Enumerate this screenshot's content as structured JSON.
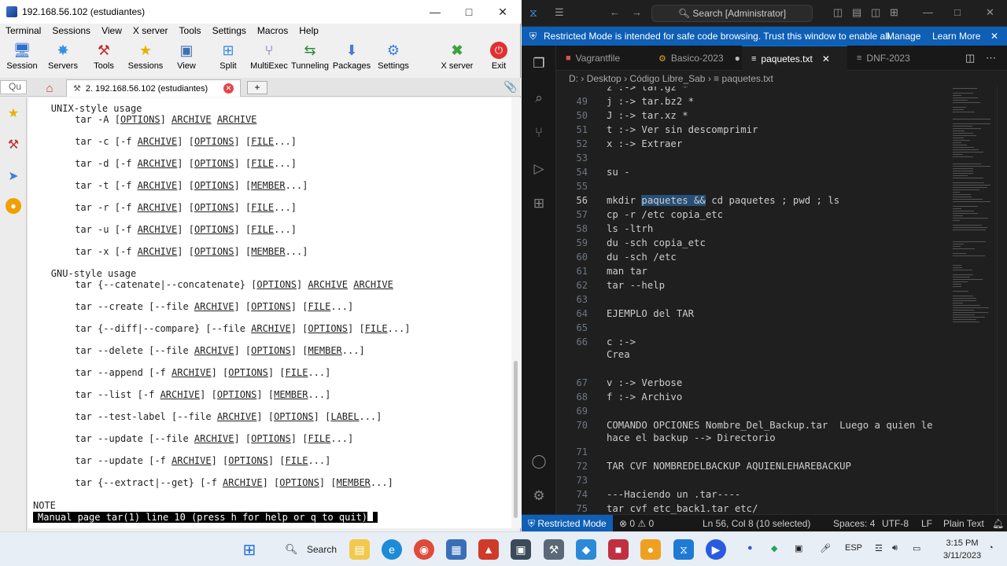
{
  "mobaxterm": {
    "window_title": "192.168.56.102 (estudiantes)",
    "menu": [
      "Terminal",
      "Sessions",
      "View",
      "X server",
      "Tools",
      "Settings",
      "Macros",
      "Help"
    ],
    "toolbar": [
      "Session",
      "Servers",
      "Tools",
      "Sessions",
      "View",
      "Split",
      "MultiExec",
      "Tunneling",
      "Packages",
      "Settings",
      "X server",
      "Exit"
    ],
    "quick_connect": "Qu",
    "session_tab": "2. 192.168.56.102 (estudiantes)",
    "terminal_lines": [
      {
        "text": "UNIX-style usage",
        "indent": 3
      },
      {
        "text": "tar -A [OPTIONS] ARCHIVE ARCHIVE",
        "indent": 7
      },
      {
        "text": "tar -c [-f ARCHIVE] [OPTIONS] [FILE...]",
        "indent": 7
      },
      {
        "text": "tar -d [-f ARCHIVE] [OPTIONS] [FILE...]",
        "indent": 7
      },
      {
        "text": "tar -t [-f ARCHIVE] [OPTIONS] [MEMBER...]",
        "indent": 7
      },
      {
        "text": "tar -r [-f ARCHIVE] [OPTIONS] [FILE...]",
        "indent": 7
      },
      {
        "text": "tar -u [-f ARCHIVE] [OPTIONS] [FILE...]",
        "indent": 7
      },
      {
        "text": "tar -x [-f ARCHIVE] [OPTIONS] [MEMBER...]",
        "indent": 7
      },
      {
        "text": "GNU-style usage",
        "indent": 3
      },
      {
        "text": "tar {--catenate|--concatenate} [OPTIONS] ARCHIVE ARCHIVE",
        "indent": 7
      },
      {
        "text": "tar --create [--file ARCHIVE] [OPTIONS] [FILE...]",
        "indent": 7
      },
      {
        "text": "tar {--diff|--compare} [--file ARCHIVE] [OPTIONS] [FILE...]",
        "indent": 7
      },
      {
        "text": "tar --delete [--file ARCHIVE] [OPTIONS] [MEMBER...]",
        "indent": 7
      },
      {
        "text": "tar --append [-f ARCHIVE] [OPTIONS] [FILE...]",
        "indent": 7
      },
      {
        "text": "tar --list [-f ARCHIVE] [OPTIONS] [MEMBER...]",
        "indent": 7
      },
      {
        "text": "tar --test-label [--file ARCHIVE] [OPTIONS] [LABEL...]",
        "indent": 7
      },
      {
        "text": "tar --update [--file ARCHIVE] [OPTIONS] [FILE...]",
        "indent": 7
      },
      {
        "text": "tar --update [-f ARCHIVE] [OPTIONS] [FILE...]",
        "indent": 7
      },
      {
        "text": "tar {--extract|--get} [-f ARCHIVE] [OPTIONS] [MEMBER...]",
        "indent": 7
      },
      {
        "text": "NOTE",
        "indent": 0
      }
    ],
    "status_line": "Manual page tar(1) line 10 (press h for help or q to quit)"
  },
  "vscode": {
    "search_placeholder": "Search [Administrator]",
    "banner_text": "Restricted Mode is intended for safe code browsing. Trust this window to enable all...",
    "banner_manage": "Manage",
    "banner_learn": "Learn More",
    "tabs": [
      {
        "label": "Vagrantfile",
        "active": false
      },
      {
        "label": "Basico-2023",
        "active": false
      },
      {
        "label": "paquetes.txt",
        "active": true
      },
      {
        "label": "DNF-2023",
        "active": false
      }
    ],
    "breadcrumb": [
      "D:",
      "Desktop",
      "Código Libre_Sab",
      "paquetes.txt"
    ],
    "code_lines": [
      {
        "num": "",
        "text": "z :-> tar.gz *"
      },
      {
        "num": "49",
        "text": "j :-> tar.bz2 *"
      },
      {
        "num": "50",
        "text": "J :-> tar.xz *"
      },
      {
        "num": "51",
        "text": "t :-> Ver sin descomprimir"
      },
      {
        "num": "52",
        "text": "x :-> Extraer"
      },
      {
        "num": "53",
        "text": ""
      },
      {
        "num": "54",
        "text": "su -"
      },
      {
        "num": "55",
        "text": ""
      },
      {
        "num": "56",
        "text": "mkdir paquetes && cd paquetes ; pwd ; ls"
      },
      {
        "num": "57",
        "text": "cp -r /etc copia_etc"
      },
      {
        "num": "58",
        "text": "ls -ltrh"
      },
      {
        "num": "59",
        "text": "du -sch copia_etc"
      },
      {
        "num": "60",
        "text": "du -sch /etc"
      },
      {
        "num": "61",
        "text": "man tar"
      },
      {
        "num": "62",
        "text": "tar --help"
      },
      {
        "num": "63",
        "text": ""
      },
      {
        "num": "64",
        "text": "EJEMPLO del TAR"
      },
      {
        "num": "65",
        "text": ""
      },
      {
        "num": "66",
        "text": "c :->"
      },
      {
        "num": "",
        "text": "Crea"
      },
      {
        "num": "",
        "text": ""
      },
      {
        "num": "67",
        "text": "v :-> Verbose"
      },
      {
        "num": "68",
        "text": "f :-> Archivo"
      },
      {
        "num": "69",
        "text": ""
      },
      {
        "num": "70",
        "text": "COMANDO OPCIONES Nombre_Del_Backup.tar  Luego a quien le"
      },
      {
        "num": "",
        "text": "hace el backup --> Directorio"
      },
      {
        "num": "71",
        "text": ""
      },
      {
        "num": "72",
        "text": "TAR CVF NOMBREDELBACKUP AQUIENLEHAREBACKUP"
      },
      {
        "num": "73",
        "text": ""
      },
      {
        "num": "74",
        "text": "---Haciendo un .tar----"
      },
      {
        "num": "75",
        "text": "tar cvf etc_back1.tar etc/"
      }
    ],
    "status": {
      "mode": "Restricted Mode",
      "problems": "⊗ 0 ⚠ 0",
      "position": "Ln 56, Col 8 (10 selected)",
      "spaces": "Spaces: 4",
      "encoding": "UTF-8",
      "eol": "LF",
      "language": "Plain Text"
    }
  },
  "taskbar": {
    "search": "Search",
    "lang": "ESP",
    "time": "3:15 PM",
    "date": "3/11/2023"
  },
  "colors": {
    "vs_accent": "#0e5fb5",
    "vs_bg": "#1f1f1f",
    "exit_red": "#e03030"
  }
}
